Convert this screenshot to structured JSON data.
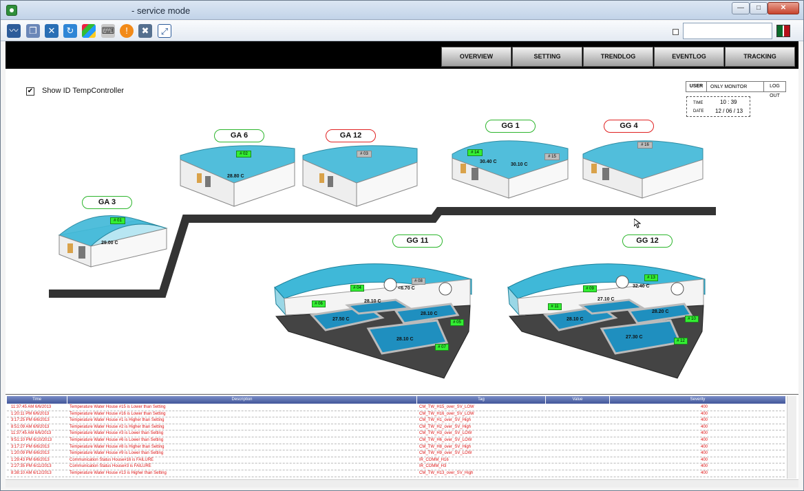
{
  "window": {
    "title": "- service mode",
    "min": "—",
    "max": "□",
    "close": "✕"
  },
  "toolbar": {
    "icons": [
      "monitor-icon",
      "windows-icon",
      "tools-icon",
      "refresh-icon",
      "windows-logo-icon",
      "keyboard-icon",
      "warning-icon",
      "network-disconnect-icon",
      "fullscreen-icon"
    ],
    "field_value": ""
  },
  "nav": {
    "tabs": [
      "OVERVIEW",
      "SETTING",
      "TRENDLOG",
      "EVENTLOG",
      "TRACKING"
    ]
  },
  "main": {
    "show_id_label": "Show ID TempController",
    "user": {
      "label": "USER",
      "value": "ONLY MONITOR",
      "logout": "LOG OUT"
    },
    "datetime": {
      "time_label": "TIME",
      "time_value": "10 : 39",
      "date_label": "DATE",
      "date_value": "12 / 06 / 13"
    },
    "houses": {
      "ga3": {
        "name": "GA 3",
        "id": "# 01",
        "temp": "29.00 C"
      },
      "ga6": {
        "name": "GA 6",
        "id": "# 02",
        "temp": "28.80 C"
      },
      "ga12": {
        "name": "GA 12",
        "id": "# 03"
      },
      "gg1": {
        "name": "GG 1",
        "id1": "# 14",
        "temp1": "30.40 C",
        "id2": "# 15",
        "temp2": "30.10 C"
      },
      "gg4": {
        "name": "GG 4",
        "id": "# 16"
      },
      "gg11": {
        "name": "GG 11",
        "ids": [
          "# 04",
          "# 08",
          "# 06",
          "# 05",
          "# 07"
        ],
        "temps": [
          "<6.70 C",
          "28.10 C",
          "27.50 C",
          "28.10 C",
          "28.10 C"
        ]
      },
      "gg12": {
        "name": "GG 12",
        "ids": [
          "# 13",
          "# 09",
          "# 11",
          "# 10",
          "# 12"
        ],
        "temps": [
          "32.40 C",
          "27.10 C",
          "28.10 C",
          "28.20 C",
          "27.30 C"
        ]
      }
    },
    "colors": {
      "normal_border": "#2bb52b",
      "alarm_border": "#e02020",
      "house_glass": "#38c0dc",
      "track": "#333333"
    }
  },
  "alarms": {
    "columns": [
      "Time",
      "Description",
      "Tag",
      "Value",
      "Severity"
    ],
    "rows": [
      [
        "11:37:45 AM  6/6/2013",
        "Temperature Water House #15 is Lower than Setting",
        "CM_TW_H15_over_SV_LOW",
        "",
        "400"
      ],
      [
        "1:20:11 PM  6/6/2013",
        "Temperature Water House #16 is Lower than Setting",
        "CM_TW_H16_over_SV_LOW",
        "",
        "400"
      ],
      [
        "3:17:25 PM  6/6/2013",
        "Temperature Water House #1 is Higher than Setting",
        "CM_TW_H1_over_SV_High",
        "",
        "400"
      ],
      [
        "8:51:09 AM  6/9/2013",
        "Temperature Water House #2 is Higher than Setting",
        "CM_TW_H2_over_SV_High",
        "",
        "400"
      ],
      [
        "11:37:45 AM  6/6/2013",
        "Temperature Water House #3 is Lower than Setting",
        "CM_TW_H3_over_SV_LOW",
        "",
        "400"
      ],
      [
        "9:51:10 PM  6/10/2013",
        "Temperature Water House #6 is Lower than Setting",
        "CM_TW_H6_over_SV_LOW",
        "",
        "400"
      ],
      [
        "3:17:27 PM  6/6/2013",
        "Temperature Water House #8 is Higher than Setting",
        "CM_TW_H8_over_SV_High",
        "",
        "400"
      ],
      [
        "1:20:09 PM  6/6/2013",
        "Temperature Water House #9 is Lower than Setting",
        "CM_TW_H9_over_SV_LOW",
        "",
        "400"
      ],
      [
        "1:29:43 PM  6/6/2013",
        "Communication Status House#16 is FAILURE",
        "IR_COMM_H16",
        "",
        "400"
      ],
      [
        "2:27:35 PM  6/11/2013",
        "Communication Status House#3 is FAILURE",
        "IR_COMM_H3",
        "",
        "400"
      ],
      [
        "8:38:10 AM  6/12/2013",
        "Temperature Water House #13 is Higher than Setting",
        "CM_TW_H13_over_SV_High",
        "",
        "400"
      ]
    ]
  }
}
